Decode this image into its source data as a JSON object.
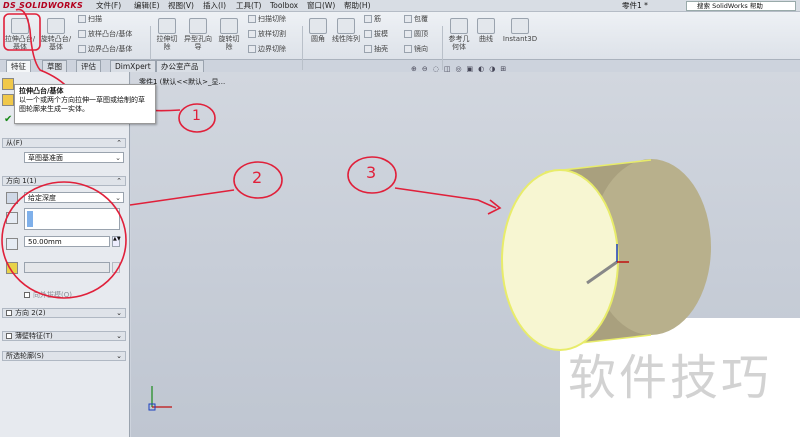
{
  "app": {
    "logo": "DS SOLIDWORKS",
    "doc_title": "零件1 *",
    "help_search": "搜索 SolidWorks 帮助"
  },
  "menu": [
    "文件(F)",
    "编辑(E)",
    "视图(V)",
    "插入(I)",
    "工具(T)",
    "Toolbox",
    "窗口(W)",
    "帮助(H)"
  ],
  "ribbon": {
    "extrude_boss": "拉伸凸台/基体",
    "revolve_boss": "旋转凸台/基体",
    "sweep": "扫描",
    "loft": "放样凸台/基体",
    "boundary": "边界凸台/基体",
    "extrude_cut": "拉伸切除",
    "hole_wizard": "异型孔向导",
    "revolve_cut": "旋转切除",
    "swept_cut": "扫描切除",
    "lofted_cut": "放样切割",
    "boundary_cut": "边界切除",
    "fillet": "圆角",
    "linear_pattern": "线性阵列",
    "rib": "筋",
    "draft": "拔模",
    "shell": "抽壳",
    "wrap": "包覆",
    "dome": "圆顶",
    "mirror": "镜向",
    "ref_geometry": "参考几何体",
    "curves": "曲线",
    "instant3d": "Instant3D"
  },
  "tabs": [
    "特征",
    "草图",
    "评估",
    "DimXpert",
    "办公室产品"
  ],
  "breadcrumb": "零件1 (默认<<默认>_显...",
  "tooltip": {
    "title": "拉伸凸台/基体",
    "desc": "以一个或两个方向拉伸一草图或绘制的草图轮廓来生成一实体。"
  },
  "panel": {
    "from_label": "从(F)",
    "from_value": "草图基准面",
    "dir1_label": "方向 1(1)",
    "end_condition": "给定深度",
    "depth": "50.00mm",
    "draft_outward": "向外拔模(O)",
    "dir2_label": "方向 2(2)",
    "thin_label": "薄壁特征(T)",
    "contours_label": "所选轮廓(S)"
  },
  "annotations": {
    "one": "1",
    "two": "2",
    "three": "3"
  },
  "watermark": "软件技巧",
  "colors": {
    "accent": "#b3001e",
    "annotation": "#e0203a",
    "selection": "#e8ec6a"
  }
}
